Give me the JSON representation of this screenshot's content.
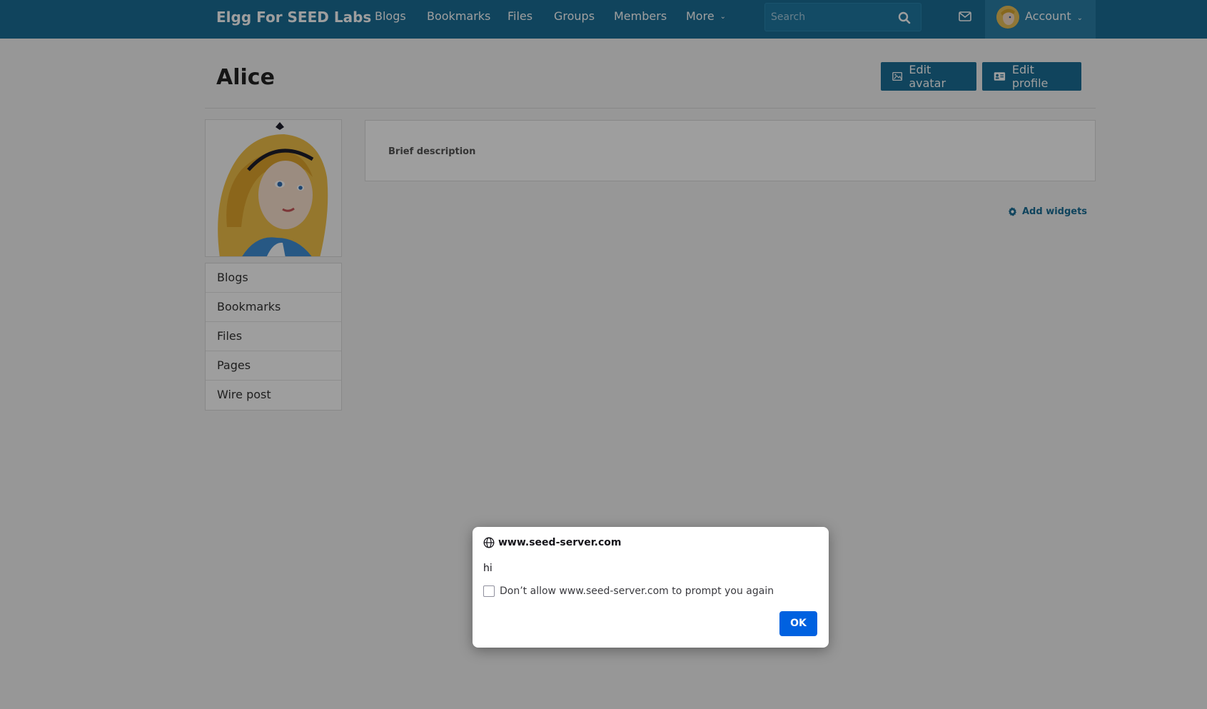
{
  "topbar": {
    "brand": "Elgg For SEED Labs",
    "nav": [
      {
        "label": "Blogs"
      },
      {
        "label": "Bookmarks"
      },
      {
        "label": "Files"
      },
      {
        "label": "Groups"
      },
      {
        "label": "Members"
      },
      {
        "label": "More"
      }
    ],
    "search": {
      "placeholder": "Search",
      "value": ""
    },
    "account_label": "Account"
  },
  "profile": {
    "name": "Alice",
    "edit_avatar_label": "Edit avatar",
    "edit_profile_label": "Edit profile",
    "owner_menu": [
      "Blogs",
      "Bookmarks",
      "Files",
      "Pages",
      "Wire post"
    ],
    "details_label": "Brief description",
    "add_widgets_label": "Add widgets"
  },
  "dialog": {
    "origin": "www.seed-server.com",
    "message": "hi",
    "checkbox_label": "Don’t allow www.seed-server.com to prompt you again",
    "checkbox_checked": false,
    "ok_label": "OK"
  },
  "colors": {
    "brand_blue": "#1b6f96",
    "dialog_button": "#0061e0"
  }
}
